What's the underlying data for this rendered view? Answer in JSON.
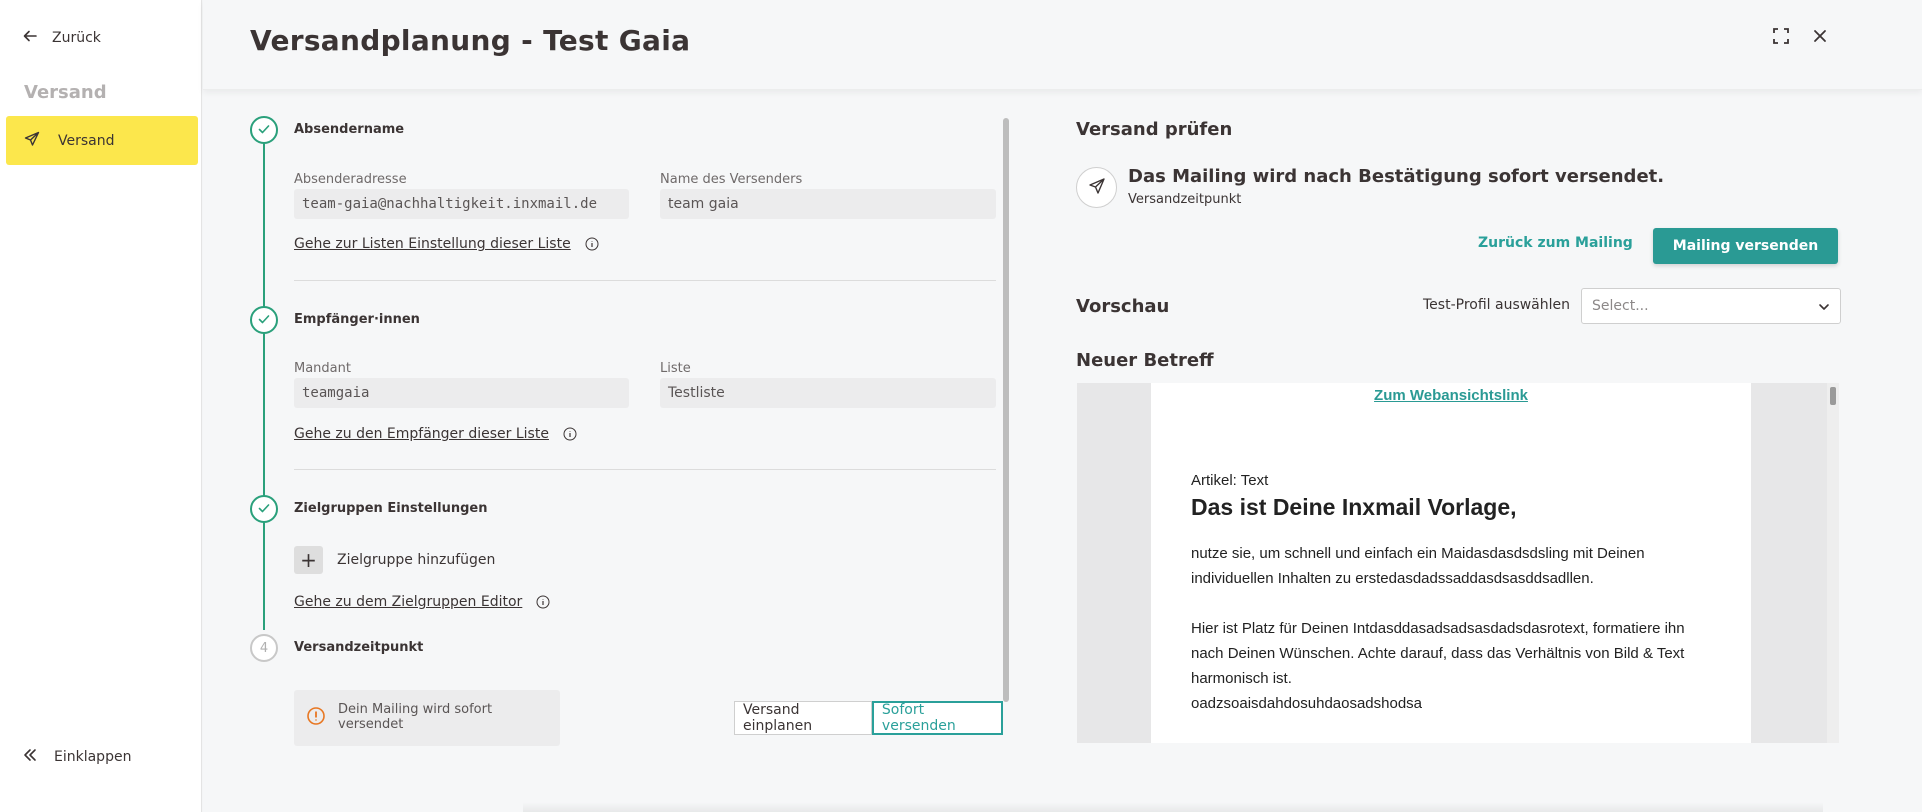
{
  "sidebar": {
    "back_label": "Zurück",
    "section_heading": "Versand",
    "active_item_label": "Versand",
    "collapse_label": "Einklappen"
  },
  "header": {
    "title": "Versandplanung - Test Gaia"
  },
  "form": {
    "step1": {
      "title": "Absendername",
      "sender_address_label": "Absenderadresse",
      "sender_address_value": "team-gaia@nachhaltigkeit.inxmail.de",
      "sender_name_label": "Name des Versenders",
      "sender_name_value": "team gaia",
      "link": "Gehe zur Listen Einstellung dieser Liste"
    },
    "step2": {
      "title": "Empfänger·innen",
      "client_label": "Mandant",
      "client_value": "teamgaia",
      "list_label": "Liste",
      "list_value": "Testliste",
      "link": "Gehe zu den Empfänger dieser Liste"
    },
    "step3": {
      "title": "Zielgruppen Einstellungen",
      "add_label": "Zielgruppe hinzufügen",
      "link": "Gehe zu dem Zielgruppen Editor"
    },
    "step4": {
      "number": "4",
      "title": "Versandzeitpunkt",
      "notice": "Dein Mailing wird sofort versendet",
      "schedule_button": "Versand einplanen",
      "send_now_button": "Sofort versenden"
    }
  },
  "review": {
    "heading": "Versand prüfen",
    "message": "Das Mailing wird nach Bestätigung sofort versendet.",
    "sub": "Versandzeitpunkt",
    "back_button": "Zurück zum Mailing",
    "send_button": "Mailing versenden"
  },
  "preview": {
    "heading": "Vorschau",
    "profile_label": "Test-Profil auswählen",
    "profile_placeholder": "Select...",
    "subject": "Neuer Betreff",
    "weblink": "Zum Webansichtslink",
    "article_label": "Artikel: Text",
    "headline": "Das ist Deine Inxmail Vorlage,",
    "para1": "nutze sie, um schnell und einfach ein Maidasdasdsdsling mit Deinen individuellen Inhalten zu erstedasdadssaddasdsasddsadllen.",
    "para2": "Hier ist Platz für Deinen Intdasddasadsadsasdadsdasrotext, formatiere ihn nach Deinen Wünschen. Achte darauf, dass das Verhältnis von Bild & Text harmonisch ist.",
    "para3": "oadzsoaisdahdosuhdaosadshodsa"
  },
  "colors": {
    "accent_yellow": "#fce74c",
    "teal": "#2a9a94",
    "step_green": "#2aa07b",
    "notice_orange": "#e87722"
  },
  "icons": {
    "back": "arrow-left-icon",
    "nav_versand": "paper-plane-icon",
    "collapse": "double-chevron-left-icon",
    "expand": "fullscreen-icon",
    "close": "close-icon",
    "check": "check-icon",
    "info": "info-icon",
    "warning": "warning-circle-icon",
    "dropdown": "chevron-down-icon"
  }
}
